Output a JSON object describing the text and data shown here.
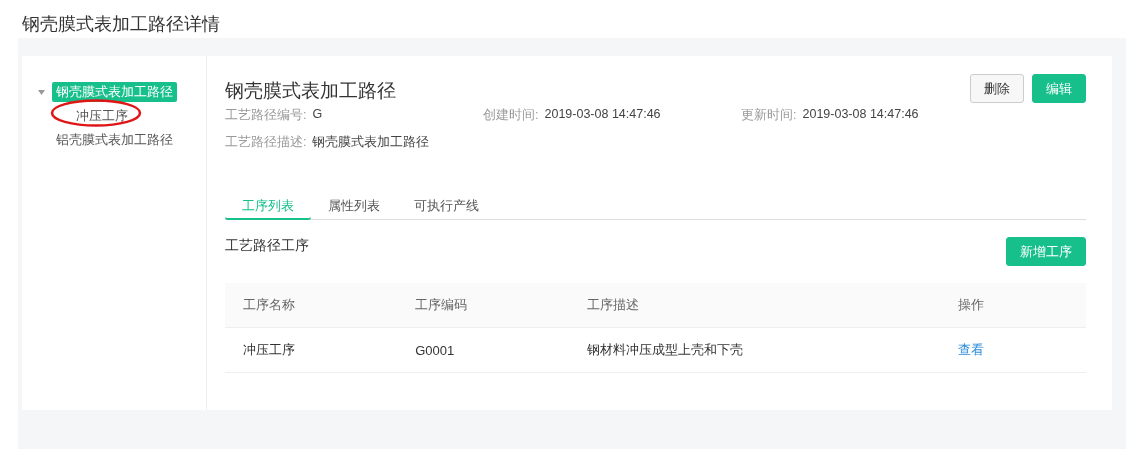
{
  "page_title": "钢壳膜式表加工路径详情",
  "tree": [
    {
      "label": "钢壳膜式表加工路径",
      "selected": true,
      "expanded": true,
      "children": [
        {
          "label": "冲压工序",
          "selected": false,
          "expanded": false
        }
      ]
    },
    {
      "label": "铝壳膜式表加工路径",
      "selected": false,
      "expanded": false
    }
  ],
  "detail": {
    "title": "钢壳膜式表加工路径",
    "buttons": [
      {
        "label": "删除",
        "kind": "default"
      },
      {
        "label": "编辑",
        "kind": "primary"
      }
    ],
    "fields": [
      {
        "label": "工艺路径编号:",
        "value": "G"
      },
      {
        "label": "创建时间:",
        "value": "2019-03-08 14:47:46"
      },
      {
        "label": "更新时间:",
        "value": "2019-03-08 14:47:46"
      },
      {
        "label": "工艺路径描述:",
        "value": "钢壳膜式表加工路径"
      }
    ]
  },
  "tabs": [
    {
      "label": "工序列表",
      "selected": true
    },
    {
      "label": "属性列表",
      "selected": false
    },
    {
      "label": "可执行产线",
      "selected": false
    }
  ],
  "section": {
    "title": "工艺路径工序",
    "add_button": "新增工序"
  },
  "table": {
    "columns": [
      "工序名称",
      "工序编码",
      "工序描述",
      "操作"
    ],
    "rows": [
      {
        "cells": [
          "冲压工序",
          "G0001",
          "钢材料冲压成型上壳和下壳"
        ],
        "action": "查看"
      }
    ]
  }
}
